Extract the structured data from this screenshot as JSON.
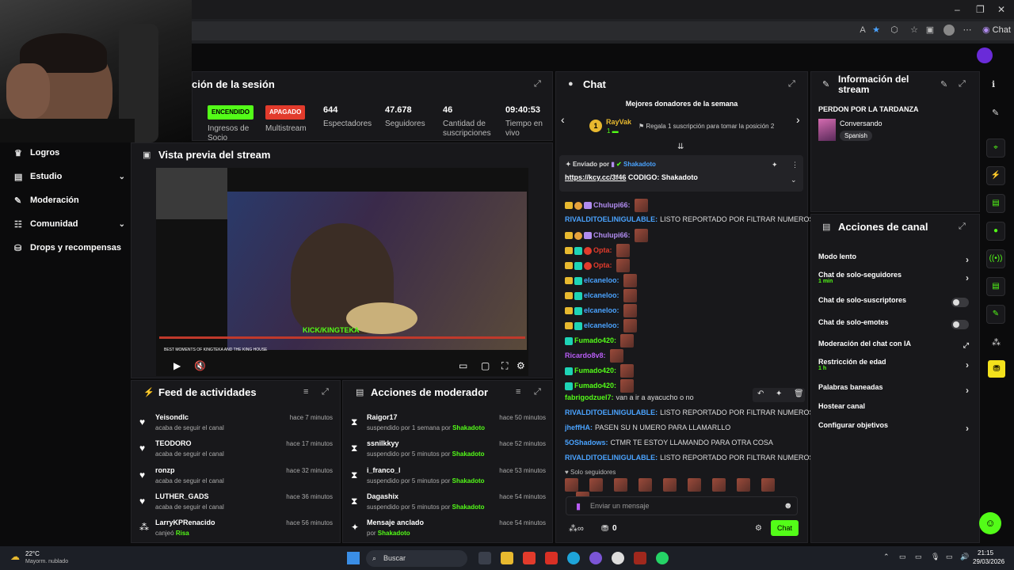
{
  "browser": {
    "chat_pill": "Chat",
    "tab_icon": "kick-icon"
  },
  "sidebar": {
    "items": [
      {
        "label": "Logros",
        "icon": "trophy-icon"
      },
      {
        "label": "Estudio",
        "icon": "studio-icon",
        "chevron": true
      },
      {
        "label": "Moderación",
        "icon": "wrench-icon"
      },
      {
        "label": "Comunidad",
        "icon": "community-icon",
        "chevron": true
      },
      {
        "label": "Drops y recompensas",
        "icon": "drops-icon"
      }
    ]
  },
  "session": {
    "title": "ción de la sesión",
    "stats": [
      {
        "badge": "ENCENDIDO",
        "badge_color": "#53fc18",
        "label": "Ingresos de Socio"
      },
      {
        "badge": "APAGADO",
        "badge_color": "#e23b2c",
        "label": "Multistream"
      },
      {
        "value": "644",
        "label": "Espectadores"
      },
      {
        "value": "47.678",
        "label": "Seguidores"
      },
      {
        "value": "46",
        "label": "Cantidad de suscripciones"
      },
      {
        "value": "09:40:53",
        "label": "Tiempo en vivo"
      }
    ]
  },
  "preview": {
    "title": "Vista previa del stream",
    "overlay_text": "KICK/KINGTEKA",
    "caption": "BEST MOMENTS OF KINGTEKA AND THE KING HOUSE"
  },
  "feed": {
    "title": "Feed de actividades",
    "rows": [
      {
        "name": "Yeisondlc",
        "sub": "acaba de seguir el canal",
        "time": "hace 7 minutos"
      },
      {
        "name": "TEODORO",
        "sub": "acaba de seguir el canal",
        "time": "hace 17 minutos"
      },
      {
        "name": "ronzp",
        "sub": "acaba de seguir el canal",
        "time": "hace 32 minutos"
      },
      {
        "name": "LUTHER_GADS",
        "sub": "acaba de seguir el canal",
        "time": "hace 36 minutos"
      },
      {
        "name": "LarryKPRenacido",
        "sub": "canjeó",
        "sub_highlight": "Risa",
        "time": "hace 56 minutos"
      }
    ]
  },
  "modactions": {
    "title": "Acciones de moderador",
    "rows": [
      {
        "name": "Raigor17",
        "sub": "suspendido por 1 semana por",
        "by": "Shakadoto",
        "time": "hace 50 minutos"
      },
      {
        "name": "ssnilkkyy",
        "sub": "suspendido por 5 minutos por",
        "by": "Shakadoto",
        "time": "hace 52 minutos"
      },
      {
        "name": "i_franco_l",
        "sub": "suspendido por 5 minutos por",
        "by": "Shakadoto",
        "time": "hace 53 minutos"
      },
      {
        "name": "Dagashix",
        "sub": "suspendido por 5 minutos por",
        "by": "Shakadoto",
        "time": "hace 54 minutos"
      },
      {
        "name": "Mensaje anclado",
        "sub": "por",
        "by": "Shakadoto",
        "time": "hace 54 minutos"
      }
    ]
  },
  "chat": {
    "title": "Chat",
    "donors_title": "Mejores donadores de la semana",
    "donor_name": "RayVak",
    "donor_rank": "1",
    "donor_count": "1",
    "donor_cta": "Regala 1 suscripción para tomar la posición 2",
    "pinned_label": "Enviado por",
    "pinned_user": "Shakadoto",
    "pinned_link": "https://kcy.cc/3f46",
    "pinned_text": "CODIGO: Shakadoto",
    "messages": [
      {
        "user": "Chulupi66:",
        "color": "#b18cf0",
        "text": "",
        "badges": "crown,sub1,subp",
        "emote": true
      },
      {
        "user": "RIVALDITOELINIGULABLE:",
        "color": "#4aa3ff",
        "text": "LISTO REPORTADO POR FILTRAR NUMEROS",
        "badges": ""
      },
      {
        "user": "Chulupi66:",
        "color": "#b18cf0",
        "text": "",
        "badges": "crown,sub1,subp",
        "emote": true
      },
      {
        "user": "Opta:",
        "color": "#e23b2c",
        "text": "",
        "badges": "crown,ksub,redb",
        "emote": true
      },
      {
        "user": "Opta:",
        "color": "#e23b2c",
        "text": "",
        "badges": "crown,ksub,redb",
        "emote": true
      },
      {
        "user": "elcaneloo:",
        "color": "#4aa3ff",
        "text": "",
        "badges": "crown,ksub",
        "emote": true
      },
      {
        "user": "elcaneloo:",
        "color": "#4aa3ff",
        "text": "",
        "badges": "crown,ksub",
        "emote": true
      },
      {
        "user": "elcaneloo:",
        "color": "#4aa3ff",
        "text": "",
        "badges": "crown,ksub",
        "emote": true
      },
      {
        "user": "elcaneloo:",
        "color": "#4aa3ff",
        "text": "",
        "badges": "crown,ksub",
        "emote": true
      },
      {
        "user": "Fumado420:",
        "color": "#53fc18",
        "text": "",
        "badges": "ksub",
        "emote": true
      },
      {
        "user": "Ricardo8v8:",
        "color": "#b85cf5",
        "text": "",
        "badges": "",
        "emote": true
      },
      {
        "user": "Fumado420:",
        "color": "#53fc18",
        "text": "",
        "badges": "ksub",
        "emote": true
      },
      {
        "user": "Fumado420:",
        "color": "#53fc18",
        "text": "",
        "badges": "ksub",
        "emote": true
      },
      {
        "user": "fabrigodzuel7:",
        "color": "#53fc18",
        "text": "van a ir a ayacucho o no",
        "badges": ""
      },
      {
        "user": "RIVALDITOELINIGULABLE:",
        "color": "#4aa3ff",
        "text": "LISTO REPORTADO POR FILTRAR NUMEROS",
        "badges": ""
      },
      {
        "user": "jheffHA:",
        "color": "#4aa3ff",
        "text": "PASEN SU N UMERO PARA LLAMARLLO",
        "badges": ""
      },
      {
        "user": "5OShadows:",
        "color": "#4aa3ff",
        "text": "CTMR TE ESTOY LLAMANDO PARA OTRA COSA",
        "badges": ""
      },
      {
        "user": "RIVALDITOELINIGULABLE:",
        "color": "#4aa3ff",
        "text": "LISTO REPORTADO POR FILTRAR NUMEROS",
        "badges": ""
      }
    ],
    "followers_only": "Solo seguidores",
    "input_placeholder": "Enviar un mensaje",
    "points": "0",
    "send_label": "Chat"
  },
  "info": {
    "title_line1": "Información del",
    "title_line2": "stream",
    "stream_title": "PERDON POR LA TARDANZA",
    "category": "Conversando",
    "language": "Spanish"
  },
  "actions": {
    "title": "Acciones de canal",
    "rows": [
      {
        "label": "Modo lento",
        "control": "arrow"
      },
      {
        "label": "Chat de solo-seguidores",
        "sub": "1 min",
        "control": "arrow"
      },
      {
        "label": "Chat de solo-suscriptores",
        "control": "toggle"
      },
      {
        "label": "Chat de solo-emotes",
        "control": "toggle"
      },
      {
        "label": "Moderación del chat con IA",
        "control": "external"
      },
      {
        "label": "Restricción de edad",
        "sub": "1 h",
        "control": "arrow"
      },
      {
        "label": "Palabras baneadas",
        "control": "arrow"
      },
      {
        "label": "Hostear canal",
        "control": "none"
      },
      {
        "label": "Configurar objetivos",
        "control": "arrow"
      }
    ]
  },
  "taskbar": {
    "weather_temp": "22°C",
    "weather_desc": "Mayorm. nublado",
    "search_label": "Buscar",
    "time": "21:15",
    "date": "29/03/2026"
  },
  "colors": {
    "accent": "#53fc18",
    "panel": "#18181b"
  }
}
